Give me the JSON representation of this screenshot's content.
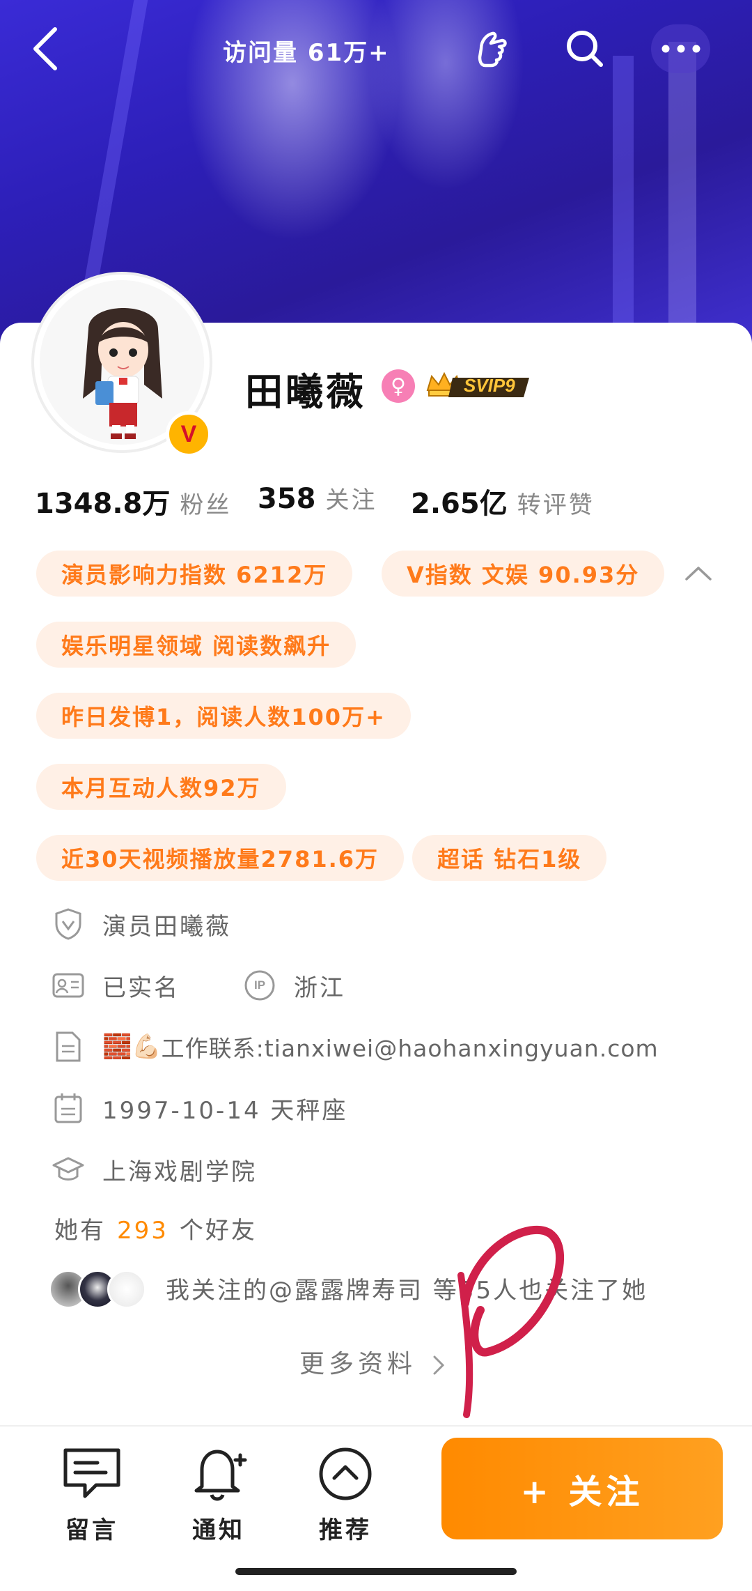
{
  "header": {
    "visits_label": "访问量 61万+",
    "icons": [
      "back-icon",
      "like-hand-icon",
      "search-icon",
      "more-icon"
    ]
  },
  "profile": {
    "name": "田曦薇",
    "badge": "SVIP9",
    "verified_mark": "V",
    "gender_symbol": "♀"
  },
  "stats": [
    {
      "num": "1348.8万",
      "label": "粉丝"
    },
    {
      "num": "358",
      "label": "关注"
    },
    {
      "num": "2.65亿",
      "label": "转评赞"
    }
  ],
  "tags": [
    "演员影响力指数 6212万",
    "V指数 文娱 90.93分",
    "娱乐明星领域 阅读数飙升",
    "昨日发博1，阅读人数100万+",
    "本月互动人数92万",
    "近30天视频播放量2781.6万",
    "超话 钻石1级"
  ],
  "info": {
    "verified_desc": "演员田曦薇",
    "real_name": "已实名",
    "ip_location": "浙江",
    "ip_label": "IP",
    "bio_prefix": "🧱💪🏻",
    "bio": "工作联系:tianxiwei@haohanxingyuan.com",
    "birthday": "1997-10-14 天秤座",
    "school": "上海戏剧学院"
  },
  "friends": {
    "prefix": "她有",
    "count": "293",
    "suffix": "个好友"
  },
  "mutual": "我关注的@露露牌寿司 等35人也关注了她",
  "more_info": "更多资料",
  "bottom_bar": {
    "message": "留言",
    "notify": "通知",
    "recommend": "推荐",
    "follow": "+ 关注"
  },
  "colors": {
    "accent": "#ff8a00",
    "tag_bg": "#fff0e6",
    "tag_text": "#ff7a1a",
    "cover": "#2d1fb8",
    "gender": "#f77fb5",
    "scribble": "#d0204a"
  }
}
